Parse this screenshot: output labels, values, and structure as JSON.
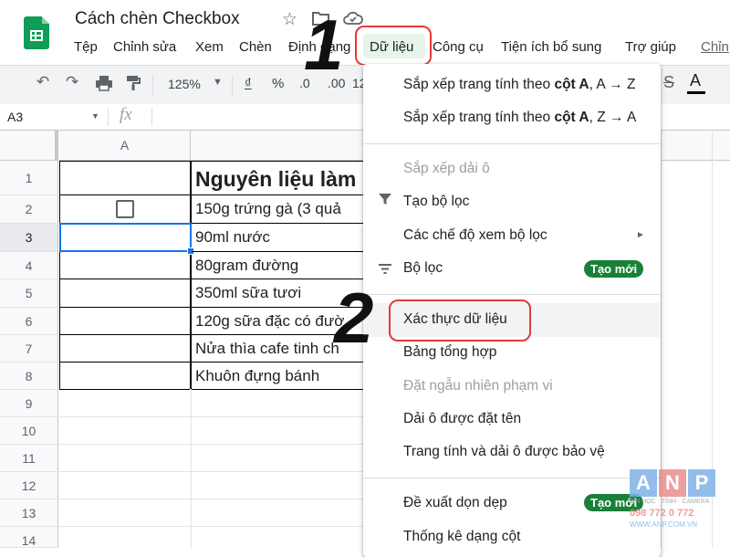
{
  "app": {
    "title": "Cách chèn Checkbox",
    "menus": [
      "Tệp",
      "Chỉnh sửa",
      "Xem",
      "Chèn",
      "Định dạng",
      "Dữ liệu",
      "Công cụ",
      "Tiện ích bổ sung",
      "Trợ giúp",
      "Chỉn"
    ]
  },
  "toolbar": {
    "zoom": "125%",
    "currency": "₫",
    "percent": "%",
    "dec_less": ".0",
    "dec_more": ".00",
    "more_formats": "12"
  },
  "formula_bar": {
    "cell_ref": "A3",
    "fx": "fx"
  },
  "sheet": {
    "col_a": "A",
    "rows": [
      "1",
      "2",
      "3",
      "4",
      "5",
      "6",
      "7",
      "8",
      "9",
      "10",
      "11",
      "12",
      "13",
      "14"
    ],
    "col_b": [
      "Nguyên liệu làm",
      "150g trứng gà (3 quả",
      "90ml nước",
      "80gram đường",
      "350ml sữa tươi",
      "120g sữa đặc có đườ",
      "Nửa thìa cafe tinh ch",
      "Khuôn đựng bánh"
    ]
  },
  "data_menu": {
    "items": [
      {
        "label_pre": "Sắp xếp trang tính theo ",
        "label_bold": "cột A",
        "label_post": ", A → Z"
      },
      {
        "label_pre": "Sắp xếp trang tính theo ",
        "label_bold": "cột A",
        "label_post": ", Z → A"
      },
      {
        "label": "Sắp xếp dải ô"
      },
      {
        "label": "Tạo bộ lọc"
      },
      {
        "label": "Các chế độ xem bộ lọc"
      },
      {
        "label": "Bộ lọc",
        "badge": "Tạo mới"
      },
      {
        "label": "Xác thực dữ liệu"
      },
      {
        "label": "Bảng tổng hợp"
      },
      {
        "label": "Đặt ngẫu nhiên phạm vi"
      },
      {
        "label": "Dải ô được đặt tên"
      },
      {
        "label": "Trang tính và dải ô được bảo vệ"
      },
      {
        "label": "Đề xuất dọn dẹp",
        "badge": "Tạo mới"
      },
      {
        "label": "Thống kê dạng cột"
      }
    ]
  },
  "steps": [
    "1",
    "2"
  ],
  "watermark": {
    "letters": "ANP",
    "line1": "TIN HỌC · TÍNH · CAMERA",
    "phone": "098 772 0 772",
    "url": "WWW.ANP.COM.VN"
  },
  "colors": {
    "sheets_green": "#0f9d58",
    "highlight_red": "#e53935",
    "badge_green": "#188038",
    "selection_blue": "#1a73e8"
  }
}
